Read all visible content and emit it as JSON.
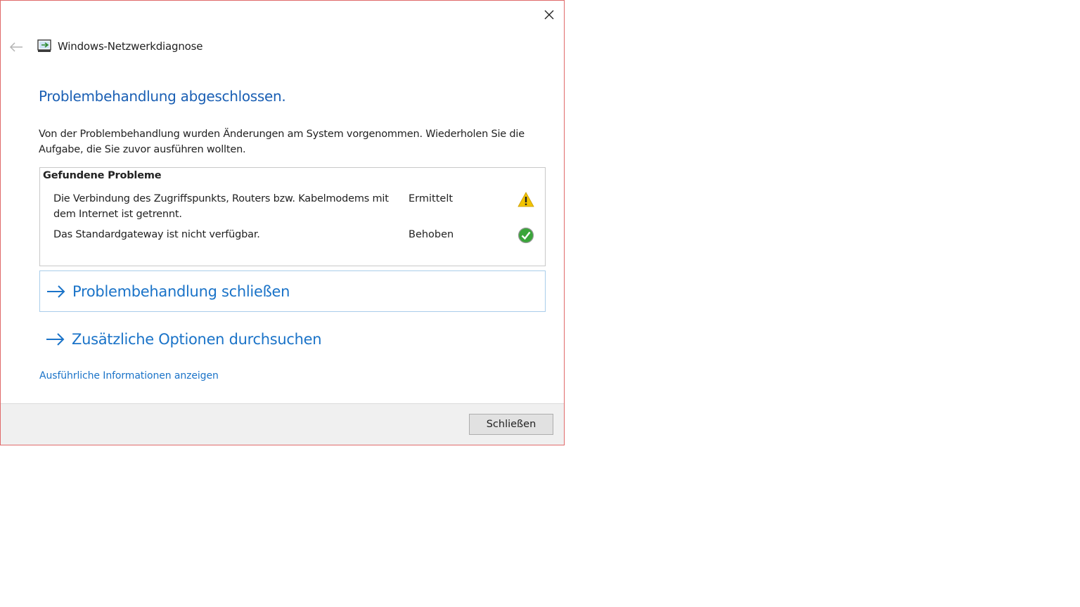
{
  "window": {
    "title": "Windows-Netzwerkdiagnose",
    "icons": {
      "close": "close-icon",
      "back": "back-arrow-icon",
      "app": "network-diagnostics-icon"
    }
  },
  "main": {
    "heading": "Problembehandlung abgeschlossen.",
    "description": "Von der Problembehandlung wurden Änderungen am System vorgenommen. Wiederholen Sie die Aufgabe, die Sie zuvor ausführen wollten.",
    "problems": {
      "title": "Gefundene Probleme",
      "items": [
        {
          "text": "Die Verbindung des Zugriffspunkts, Routers bzw. Kabelmodems mit dem Internet ist getrennt.",
          "status": "Ermittelt",
          "icon": "warning-icon"
        },
        {
          "text": "Das Standardgateway ist nicht verfügbar.",
          "status": "Behoben",
          "icon": "check-icon"
        }
      ]
    },
    "actions": [
      {
        "label": "Problembehandlung schließen",
        "icon": "arrow-right-icon"
      },
      {
        "label": "Zusätzliche Optionen durchsuchen",
        "icon": "arrow-right-icon"
      }
    ],
    "details_link": "Ausführliche Informationen anzeigen"
  },
  "footer": {
    "close_button": "Schließen"
  },
  "colors": {
    "accent": "#1a73c8",
    "heading": "#1a5fb4",
    "window_border": "#e06a6a",
    "footer_bg": "#f0f0f0",
    "warning": "#f2c400",
    "success": "#3aa53a"
  }
}
